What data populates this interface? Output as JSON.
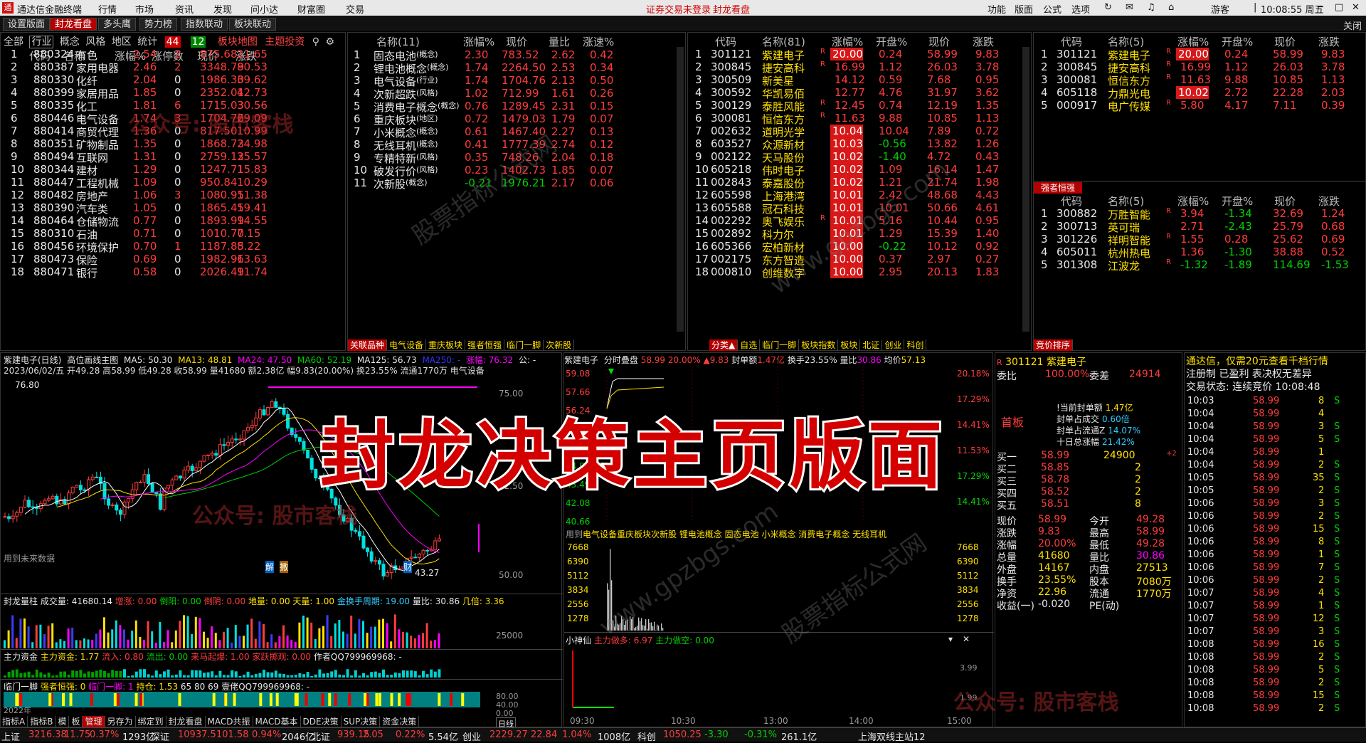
{
  "app": {
    "title": "通达信金融终端",
    "menus": [
      "行情",
      "市场",
      "资讯",
      "发现",
      "问小达",
      "财富圈",
      "交易"
    ],
    "login_status": "证券交易未登录",
    "login_mode": "封龙看盘",
    "right_menus": [
      "功能",
      "版面",
      "公式",
      "选项"
    ],
    "user": "游客",
    "clock": "10:08:55 周五",
    "close_label": "关闭"
  },
  "tabs": [
    "设置版面",
    "封龙看盘",
    "多头鹰",
    "势力榜",
    "指数联动",
    "板块联动"
  ],
  "sector": {
    "filters": [
      "全部",
      "行业",
      "概念",
      "风格",
      "地区",
      "统计"
    ],
    "badge_up": "44",
    "badge_down": "12",
    "views": [
      "板块地图",
      "主题投资"
    ],
    "headers": [
      "代码",
      "名称",
      "涨幅%",
      "涨停数",
      "现价",
      "涨跌"
    ],
    "rows": [
      [
        "1",
        "880324",
        "有色",
        "2.54",
        "2",
        "875.68",
        "21.65"
      ],
      [
        "2",
        "880387",
        "家用电器",
        "2.46",
        "2",
        "3348.79",
        "80.53"
      ],
      [
        "3",
        "880330",
        "化纤",
        "2.04",
        "0",
        "1986.30",
        "39.62"
      ],
      [
        "4",
        "880399",
        "家居用品",
        "1.85",
        "0",
        "2352.01",
        "42.73"
      ],
      [
        "5",
        "880335",
        "化工",
        "1.81",
        "6",
        "1715.03",
        "30.56"
      ],
      [
        "6",
        "880446",
        "电气设备",
        "1.74",
        "3",
        "1704.76",
        "29.09"
      ],
      [
        "7",
        "880414",
        "商贸代理",
        "1.36",
        "0",
        "817.50",
        "10.99"
      ],
      [
        "8",
        "880351",
        "矿物制品",
        "1.35",
        "0",
        "1868.73",
        "24.98"
      ],
      [
        "9",
        "880494",
        "互联网",
        "1.31",
        "0",
        "2759.12",
        "35.57"
      ],
      [
        "10",
        "880344",
        "建材",
        "1.29",
        "0",
        "1247.71",
        "15.83"
      ],
      [
        "11",
        "880447",
        "工程机械",
        "1.09",
        "0",
        "950.84",
        "10.29"
      ],
      [
        "12",
        "880482",
        "房地产",
        "1.06",
        "3",
        "1080.95",
        "11.38"
      ],
      [
        "13",
        "880390",
        "汽车类",
        "1.05",
        "0",
        "1865.45",
        "19.41"
      ],
      [
        "14",
        "880464",
        "仓储物流",
        "0.77",
        "0",
        "1893.99",
        "14.55"
      ],
      [
        "15",
        "880310",
        "石油",
        "0.71",
        "0",
        "1010.70",
        "7.15"
      ],
      [
        "16",
        "880456",
        "环境保护",
        "0.70",
        "1",
        "1187.85",
        "8.22"
      ],
      [
        "17",
        "880473",
        "保险",
        "0.69",
        "0",
        "1982.96",
        "13.63"
      ],
      [
        "18",
        "880471",
        "银行",
        "0.58",
        "0",
        "2026.49",
        "11.74"
      ]
    ]
  },
  "concept": {
    "headers": [
      "名称(11)",
      "涨幅%",
      "现价",
      "量比",
      "涨速%"
    ],
    "rows": [
      [
        "1",
        "固态电池",
        "(概念)",
        "2.30",
        "783.52",
        "2.62",
        "0.42"
      ],
      [
        "2",
        "锂电池概念",
        "(概念)",
        "1.74",
        "2264.50",
        "2.53",
        "0.34"
      ],
      [
        "3",
        "电气设备",
        "(行业)",
        "1.74",
        "1704.76",
        "2.13",
        "0.50"
      ],
      [
        "4",
        "次新超跌",
        "(风格)",
        "1.02",
        "712.99",
        "1.61",
        "0.26"
      ],
      [
        "5",
        "消费电子概念",
        "(概念)",
        "0.76",
        "1289.45",
        "2.31",
        "0.15"
      ],
      [
        "6",
        "重庆板块",
        "(地区)",
        "0.72",
        "1479.03",
        "1.79",
        "0.07"
      ],
      [
        "7",
        "小米概念",
        "(概念)",
        "0.61",
        "1467.40",
        "2.27",
        "0.13"
      ],
      [
        "8",
        "无线耳机",
        "(概念)",
        "0.41",
        "1777.39",
        "2.74",
        "0.12"
      ],
      [
        "9",
        "专精特新",
        "(风格)",
        "0.35",
        "748.26",
        "2.04",
        "0.18"
      ],
      [
        "10",
        "破发行价",
        "(风格)",
        "0.23",
        "1402.73",
        "1.85",
        "0.07"
      ],
      [
        "11",
        "次新股",
        "(概念)",
        "-0.21",
        "1976.21",
        "2.17",
        "0.06"
      ]
    ],
    "bottom_tabs": [
      "关联品种",
      "电气设备",
      "重庆板块",
      "强者恒强",
      "临门一脚",
      "次新股"
    ]
  },
  "limit": {
    "headers": [
      "代码",
      "名称(81)",
      "涨幅%",
      "开盘%",
      "现价",
      "涨跌"
    ],
    "rows": [
      [
        "1",
        "301121",
        "紫建电子",
        "R",
        "20.00",
        "0.24",
        "58.99",
        "9.83",
        "box"
      ],
      [
        "2",
        "300845",
        "捷安高科",
        "R",
        "16.99",
        "1.12",
        "26.03",
        "3.78",
        ""
      ],
      [
        "3",
        "300509",
        "新美星",
        "",
        "14.12",
        "0.59",
        "7.68",
        "0.95",
        ""
      ],
      [
        "4",
        "300592",
        "华凯易佰",
        "",
        "12.77",
        "4.76",
        "31.97",
        "3.62",
        ""
      ],
      [
        "5",
        "300129",
        "泰胜风能",
        "R",
        "12.45",
        "0.74",
        "12.19",
        "1.35",
        ""
      ],
      [
        "6",
        "300081",
        "恒信东方",
        "R",
        "11.63",
        "9.88",
        "10.85",
        "1.13",
        ""
      ],
      [
        "7",
        "002632",
        "道明光学",
        "",
        "10.04",
        "10.04",
        "7.89",
        "0.72",
        "box"
      ],
      [
        "8",
        "603527",
        "众源新材",
        "",
        "10.03",
        "-0.56",
        "13.82",
        "1.26",
        "box"
      ],
      [
        "9",
        "002122",
        "天马股份",
        "",
        "10.02",
        "-1.40",
        "4.72",
        "0.43",
        "box"
      ],
      [
        "10",
        "605218",
        "伟时电子",
        "",
        "10.02",
        "1.09",
        "16.14",
        "1.47",
        "box"
      ],
      [
        "11",
        "002843",
        "泰嘉股份",
        "",
        "10.02",
        "1.21",
        "21.74",
        "1.98",
        "box"
      ],
      [
        "12",
        "605598",
        "上海港湾",
        "",
        "10.01",
        "2.42",
        "48.68",
        "4.43",
        "box"
      ],
      [
        "13",
        "605588",
        "冠石科技",
        "",
        "10.01",
        "10.01",
        "50.66",
        "4.61",
        "box"
      ],
      [
        "14",
        "002292",
        "奥飞娱乐",
        "R",
        "10.01",
        "5.16",
        "10.44",
        "0.95",
        "box"
      ],
      [
        "15",
        "002892",
        "科力尔",
        "",
        "10.01",
        "1.29",
        "15.39",
        "1.40",
        "box"
      ],
      [
        "16",
        "605366",
        "宏柏新材",
        "",
        "10.00",
        "-0.22",
        "10.12",
        "0.92",
        "box"
      ],
      [
        "17",
        "002175",
        "东方智造",
        "",
        "10.00",
        "0.37",
        "2.97",
        "0.27",
        "box"
      ],
      [
        "18",
        "000810",
        "创维数字",
        "",
        "10.00",
        "2.95",
        "20.13",
        "1.83",
        "box"
      ]
    ],
    "bottom_tabs": [
      "分类▲",
      "自选",
      "临门一脚",
      "板块指数",
      "板块",
      "北证",
      "创业",
      "科创"
    ]
  },
  "top5": {
    "headers": [
      "代码",
      "名称(5)",
      "涨幅%",
      "开盘%",
      "现价",
      "涨跌"
    ],
    "rows": [
      [
        "1",
        "301121",
        "紫建电子",
        "R",
        "20.00",
        "0.24",
        "58.99",
        "9.83",
        "box"
      ],
      [
        "2",
        "300845",
        "捷安高科",
        "R",
        "16.99",
        "1.12",
        "26.03",
        "3.78",
        ""
      ],
      [
        "3",
        "300081",
        "恒信东方",
        "R",
        "11.63",
        "9.88",
        "10.85",
        "1.13",
        ""
      ],
      [
        "4",
        "605118",
        "力鼎光电",
        "",
        "10.02",
        "2.72",
        "22.28",
        "2.03",
        "box"
      ],
      [
        "5",
        "000917",
        "电广传媒",
        "R",
        "5.80",
        "4.17",
        "7.11",
        "0.39",
        ""
      ]
    ]
  },
  "strong": {
    "label": "强者恒强",
    "headers": [
      "代码",
      "名称(5)",
      "涨幅%",
      "开盘%",
      "现价",
      "涨跌"
    ],
    "rows": [
      [
        "1",
        "300882",
        "万胜智能",
        "R",
        "3.94",
        "-1.34",
        "32.69",
        "1.24"
      ],
      [
        "2",
        "300713",
        "英可瑞",
        "",
        "2.71",
        "-2.43",
        "25.79",
        "0.68"
      ],
      [
        "3",
        "301226",
        "祥明智能",
        "R",
        "1.55",
        "0.28",
        "25.62",
        "0.69"
      ],
      [
        "4",
        "605011",
        "杭州热电",
        "",
        "1.36",
        "-1.30",
        "38.88",
        "0.52"
      ],
      [
        "5",
        "301308",
        "江波龙",
        "R",
        "-1.32",
        "-1.89",
        "114.69",
        "-1.53"
      ]
    ],
    "bottom_tab": "竞价排序"
  },
  "kline": {
    "title": "紫建电子(日线)",
    "subtitle": "高位画线主图",
    "ma": [
      "MA5: 50.30",
      "MA13: 48.81",
      "MA24: 47.50",
      "MA60: 52.19",
      "MA125: 56.73",
      "MA250: -",
      "涨幅: 76.32",
      "公: -"
    ],
    "info": "2023/06/02/五 开49.28 高58.99 低49.28 收58.99 量41680 额2.38亿 幅9.83(20.00%) 换23.55% 流通1770万 电气设备",
    "high_label": "76.80",
    "low_label": "43.27",
    "future_note": "用到未来数据",
    "mark1": "解",
    "mark2": "撒",
    "mark3": "财",
    "y_labels": [
      "75.00",
      "62.50",
      "50.00"
    ],
    "ind1": {
      "title": "封龙量柱",
      "items": [
        "成交量: 41680.14",
        "增涨: 0.00",
        "倒阳: 0.00",
        "倒阴: 0.00",
        "地量: 0.00",
        "天量: 1.00",
        "金换手周期: 19.00",
        "量比: 30.86",
        "几倍: 3.36"
      ],
      "y": "25000"
    },
    "ind2": {
      "title": "主力资金",
      "items": [
        "主力资金: 1.77",
        "流入: 0.80",
        "流出: 0.00",
        "来马起爆: 1.00",
        "家跃掷观: 0.00",
        "作者QQ799969968: -"
      ]
    },
    "ind3": {
      "title": "临门一脚",
      "items": [
        "强者恒强: 0",
        "临门一脚: 1",
        "持仓: 1.53",
        "65",
        "80",
        "69",
        "壹佬QQ799969968: -"
      ],
      "y": [
        "80.00",
        "40.00",
        "0.00"
      ]
    },
    "year": "2022年",
    "period": "日线"
  },
  "kline_tabs": [
    "指标A",
    "指标B",
    "模",
    "板",
    "管理",
    "另存为",
    "绑定到",
    "封龙看盘",
    "MACD共振",
    "MACD基本",
    "DDE决策",
    "SUP决策",
    "资金决策"
  ],
  "intraday": {
    "title": "紫建电子",
    "mode": "分时叠盘",
    "price": "58.99",
    "pct": "20.00%",
    "chg": "▲9.83",
    "seal": "封单额",
    "seal_v": "1.47亿",
    "turnover": "换手",
    "turnover_v": "23.55%",
    "vr": "量比",
    "vr_v": "30.86",
    "avg": "均价",
    "avg_v": "57.13",
    "left_y": [
      "59.08",
      "57.66",
      "56.24",
      "54.83",
      "53.41",
      "44.91",
      "43.49",
      "42.08",
      "40.66"
    ],
    "right_y": [
      "20.18%",
      "17.29%",
      "14.41%",
      "11.53%",
      "17.29%",
      "14.41%"
    ],
    "vol_y": [
      "7668",
      "6390",
      "5112",
      "3834",
      "2556",
      "1278"
    ],
    "used": "用到",
    "concepts": "电气设备重庆板块次新股 锂电池概念 固态电池 小米概念 消费电子概念 无线耳机",
    "sub_title": "小神仙",
    "sub1": "主力做多: 6.97",
    "sub2": "主力做空: 0.00",
    "sub_y": [
      "3.99",
      "1.99"
    ],
    "times": [
      "09:30",
      "10:30",
      "13:00",
      "14:00",
      "15:00"
    ]
  },
  "quote": {
    "code": "301121",
    "name": "紫建电子",
    "weibi_label": "委比",
    "weibi": "100.00%",
    "weicha_label": "委差",
    "weicha": "24914",
    "board": "首板",
    "seal_lines": [
      [
        "!当前封单额",
        "1.47亿"
      ],
      [
        "封单占成交",
        "0.60倍"
      ],
      [
        "封单占流通Z",
        "14.07%"
      ],
      [
        "十日总涨幅",
        "21.42%"
      ]
    ],
    "bids": [
      [
        "买一",
        "58.99",
        "24900",
        "+2"
      ],
      [
        "买二",
        "58.85",
        "2",
        ""
      ],
      [
        "买三",
        "58.78",
        "2",
        ""
      ],
      [
        "买四",
        "58.52",
        "2",
        ""
      ],
      [
        "买五",
        "58.51",
        "8",
        ""
      ]
    ],
    "stats": [
      [
        "现价",
        "58.99",
        "今开",
        "49.28"
      ],
      [
        "涨跌",
        "9.83",
        "最高",
        "58.99"
      ],
      [
        "涨幅",
        "20.00%",
        "最低",
        "49.28"
      ],
      [
        "总量",
        "41680",
        "量比",
        "30.86"
      ],
      [
        "外盘",
        "14167",
        "内盘",
        "27513"
      ],
      [
        "换手",
        "23.55%",
        "股本",
        "7080万"
      ],
      [
        "净资",
        "22.96",
        "流通",
        "1770万"
      ],
      [
        "收益(一)",
        "-0.020",
        "PE(动)",
        ""
      ]
    ]
  },
  "ticks": {
    "ad": "通达信，仅需20元查看千档行情",
    "reg": "注册制 已盈利 表决权无差异",
    "state": "交易状态: 连续竞价 10:08:48",
    "rows": [
      [
        "10:03",
        "58.99",
        "8",
        "S"
      ],
      [
        "10:04",
        "58.99",
        "4",
        ""
      ],
      [
        "10:04",
        "58.99",
        "3",
        "S"
      ],
      [
        "10:04",
        "58.99",
        "5",
        "S"
      ],
      [
        "10:04",
        "58.99",
        "1",
        ""
      ],
      [
        "10:04",
        "58.99",
        "2",
        "S"
      ],
      [
        "10:05",
        "58.99",
        "35",
        "S"
      ],
      [
        "10:05",
        "58.99",
        "2",
        "S"
      ],
      [
        "10:06",
        "58.99",
        "3",
        "S"
      ],
      [
        "10:06",
        "58.99",
        "2",
        "S"
      ],
      [
        "10:06",
        "58.99",
        "15",
        "S"
      ],
      [
        "10:06",
        "58.99",
        "8",
        "S"
      ],
      [
        "10:06",
        "58.99",
        "1",
        "S"
      ],
      [
        "10:06",
        "58.99",
        "7",
        "S"
      ],
      [
        "10:06",
        "58.99",
        "2",
        "S"
      ],
      [
        "10:07",
        "58.99",
        "4",
        "S"
      ],
      [
        "10:07",
        "58.99",
        "1",
        "S"
      ],
      [
        "10:07",
        "58.99",
        "12",
        "S"
      ],
      [
        "10:07",
        "58.99",
        "3",
        "S"
      ],
      [
        "10:08",
        "58.99",
        "16",
        "S"
      ],
      [
        "10:08",
        "58.99",
        "2",
        "S"
      ],
      [
        "10:08",
        "58.99",
        "5",
        "S"
      ],
      [
        "10:08",
        "58.99",
        "2",
        "S"
      ],
      [
        "10:08",
        "58.99",
        "15",
        "S"
      ],
      [
        "10:08",
        "58.99",
        "2",
        "S"
      ]
    ]
  },
  "overlay": "封龙决策主页版面",
  "watermarks": [
    "股票指标公式网",
    "www.gpzbgs.com",
    "公众号: 股市客栈"
  ],
  "status": {
    "items": [
      "上证",
      "3216.38",
      "11.75",
      "0.37%",
      "1293亿",
      "深证",
      "10937.5",
      "101.58",
      "0.94%",
      "2046亿",
      "北证",
      "939.15",
      "2.05",
      "0.22%",
      "5.54亿",
      "创业",
      "2229.27",
      "22.84",
      "1.04%",
      "1008亿",
      "科创",
      "1050.25",
      "-3.30",
      "-0.31%",
      "261.1亿",
      "上海双线主站12"
    ]
  }
}
